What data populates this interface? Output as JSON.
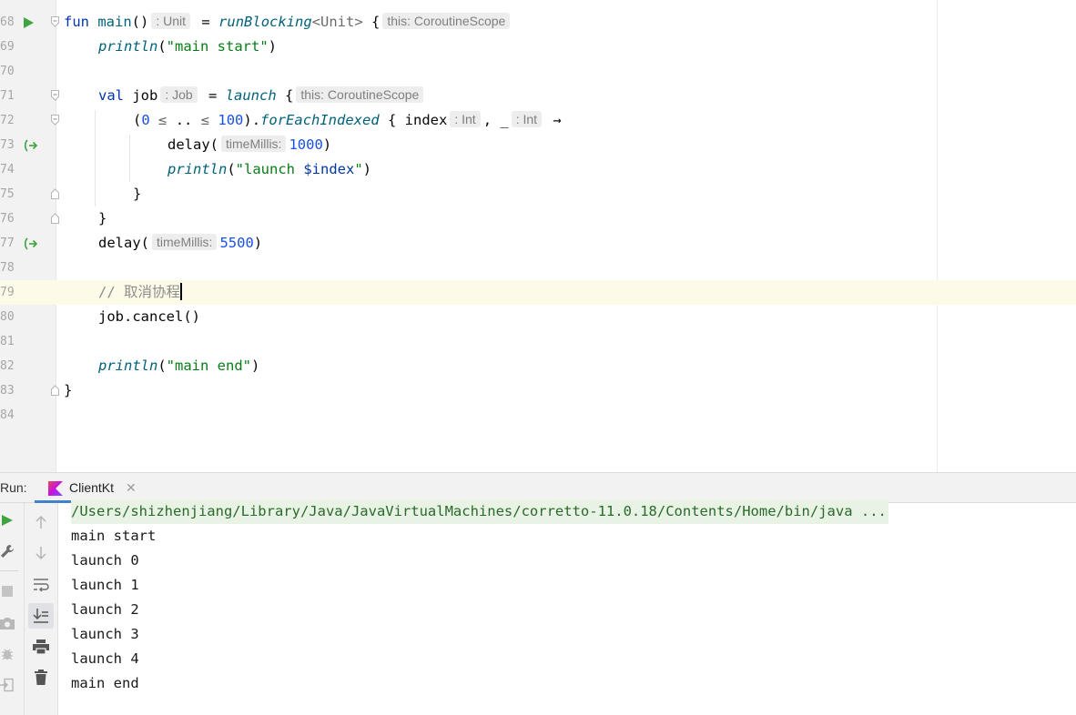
{
  "editor": {
    "lines": [
      {
        "num": "68",
        "kw_fun": "fun",
        "name": "main",
        "parens": "()",
        "hint_type": ": Unit",
        "eq": " = ",
        "fn": "runBlocking",
        "generic": "<Unit>",
        "brace": " {",
        "hint_this": "this: CoroutineScope"
      },
      {
        "num": "69",
        "fn": "println",
        "open": "(",
        "str": "\"main start\"",
        "close": ")"
      },
      {
        "num": "70"
      },
      {
        "num": "71",
        "kw_val": "val",
        "name": " job",
        "hint_type": ": Job",
        "eq": " = ",
        "fn": "launch",
        "brace": " {",
        "hint_this": "this: CoroutineScope"
      },
      {
        "num": "72",
        "open": "(",
        "n0": "0",
        "le1": " ≤ ",
        "dots": "..",
        "le2": " ≤ ",
        "n100": "100",
        "close": ").",
        "fn": "forEachIndexed",
        "brace": " { index",
        "hint_index": ": Int",
        "comma": ", _",
        "hint_under": ": Int",
        "arrow": " →"
      },
      {
        "num": "73",
        "fn": "delay(",
        "hint_param": "timeMillis:",
        "value": "1000",
        "close": ")"
      },
      {
        "num": "74",
        "fn": "println",
        "open": "(",
        "str1": "\"launch ",
        "tmpl": "$index",
        "str2": "\"",
        "close": ")"
      },
      {
        "num": "75",
        "text": "}"
      },
      {
        "num": "76",
        "text": "}"
      },
      {
        "num": "77",
        "fn": "delay(",
        "hint_param": "timeMillis:",
        "value": "5500",
        "close": ")"
      },
      {
        "num": "78"
      },
      {
        "num": "79",
        "comment": "// 取消协程"
      },
      {
        "num": "80",
        "text": "job.cancel()"
      },
      {
        "num": "81"
      },
      {
        "num": "82",
        "fn": "println",
        "open": "(",
        "str": "\"main end\"",
        "close": ")"
      },
      {
        "num": "83",
        "text": "}"
      },
      {
        "num": "84"
      }
    ]
  },
  "run_panel": {
    "label": "Run:",
    "tab_label": "ClientKt",
    "tab_close": "✕",
    "left_toolbar": [
      "run-icon",
      "wrench-icon",
      "stop-icon",
      "camera-icon",
      "debug-icon",
      "exit-icon"
    ],
    "right_toolbar": [
      "up-arrow-icon",
      "down-arrow-icon",
      "soft-wrap-icon",
      "scroll-to-end-icon",
      "print-icon",
      "trash-icon"
    ],
    "console_lines": [
      "/Users/shizhenjiang/Library/Java/JavaVirtualMachines/corretto-11.0.18/Contents/Home/bin/java ...",
      "main start",
      "launch 0",
      "launch 1",
      "launch 2",
      "launch 3",
      "launch 4",
      "main end"
    ]
  },
  "colors": {
    "keyword": "#0033b3",
    "function_italic": "#00627a",
    "string": "#067d17",
    "number": "#1750eb",
    "comment": "#8c8c8c",
    "current_line": "#fdfbe8",
    "tab_underline": "#4083c9"
  }
}
